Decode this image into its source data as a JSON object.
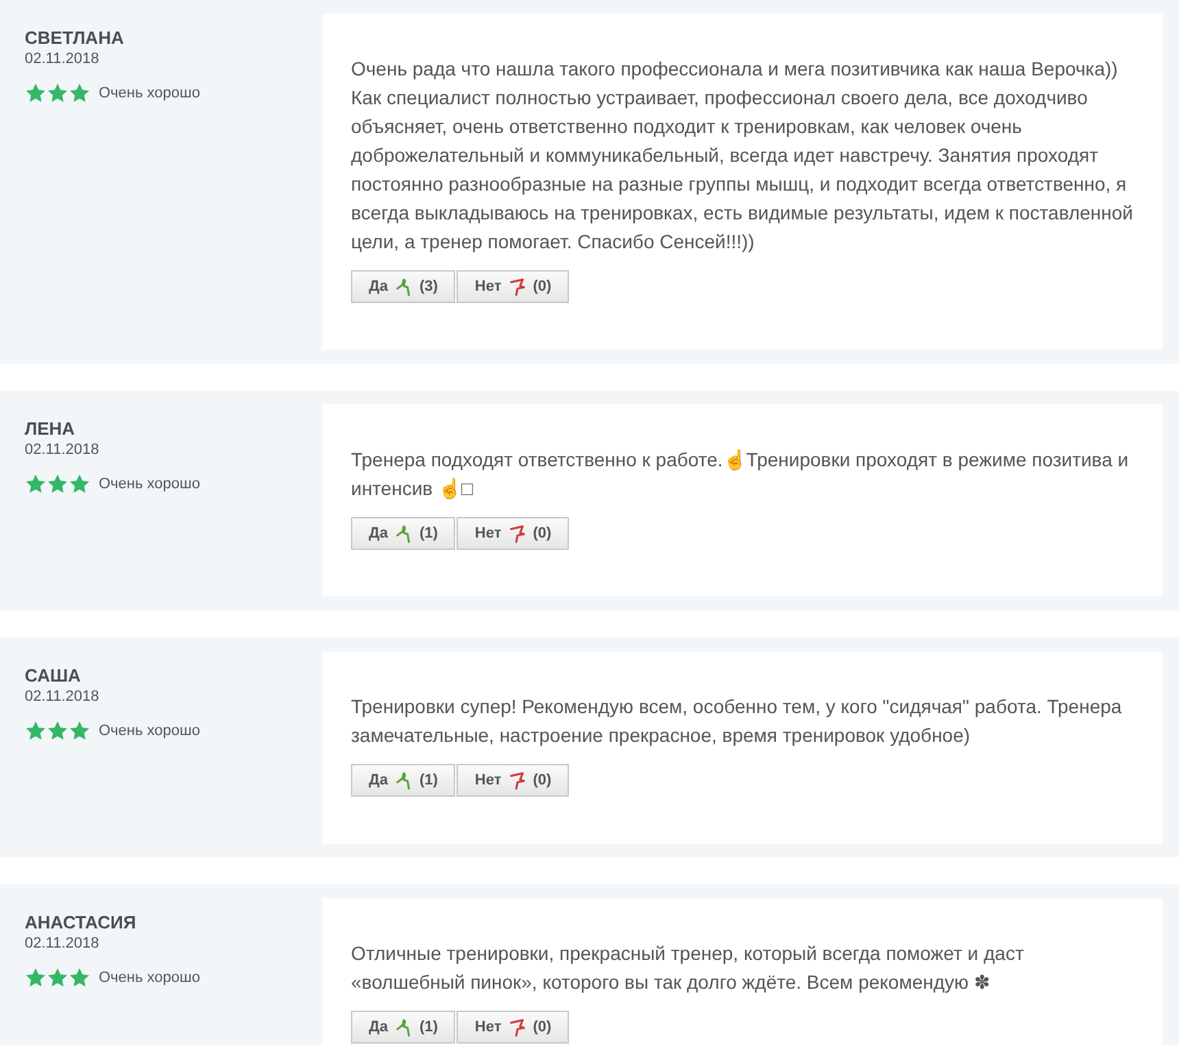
{
  "reviews": [
    {
      "name": "СВЕТЛАНА",
      "date": "02.11.2018",
      "stars": 3,
      "rating_label": "Очень хорошо",
      "text": "Очень рада что нашла такого профессионала и мега позитивчика как наша Верочка)) Как специалист полностью устраивает, профессионал своего дела, все доходчиво объясняет, очень ответственно подходит к тренировкам, как человек очень доброжелательный и коммуникабельный, всегда идет навстречу. Занятия проходят постоянно разнообразные на разные группы мышц, и подходит всегда ответственно, я всегда выкладываюсь на тренировках, есть видимые результаты, идем к поставленной цели, а тренер помогает. Спасибо Сенсей!!!))",
      "votes": [
        {
          "kind": "yes",
          "label": "Да",
          "count": "(3)"
        },
        {
          "kind": "no",
          "label": "Нет",
          "count": "(0)"
        }
      ]
    },
    {
      "name": "ЛЕНА",
      "date": "02.11.2018",
      "stars": 3,
      "rating_label": "Очень хорошо",
      "text": "Тренера подходят ответственно к работе.☝Тренировки проходят в режиме позитива и интенсив ☝□",
      "votes": [
        {
          "kind": "yes",
          "label": "Да",
          "count": "(1)"
        },
        {
          "kind": "no",
          "label": "Нет",
          "count": "(0)"
        }
      ]
    },
    {
      "name": "САША",
      "date": "02.11.2018",
      "stars": 3,
      "rating_label": "Очень хорошо",
      "text": "Тренировки супер! Рекомендую всем, особенно тем, у кого \"сидячая\" работа. Тренера замечательные, настроение прекрасное, время тренировок удобное)",
      "votes": [
        {
          "kind": "yes",
          "label": "Да",
          "count": "(1)"
        },
        {
          "kind": "no",
          "label": "Нет",
          "count": "(0)"
        }
      ]
    },
    {
      "name": "АНАСТАСИЯ",
      "date": "02.11.2018",
      "stars": 3,
      "rating_label": "Очень хорошо",
      "text": "Отличные тренировки, прекрасный тренер, который всегда поможет и даст «волшебный пинок», которого вы так долго ждёте. Всем рекомендую ✽",
      "votes": [
        {
          "kind": "yes",
          "label": "Да",
          "count": "(1)"
        },
        {
          "kind": "no",
          "label": "Нет",
          "count": "(0)"
        }
      ]
    }
  ]
}
